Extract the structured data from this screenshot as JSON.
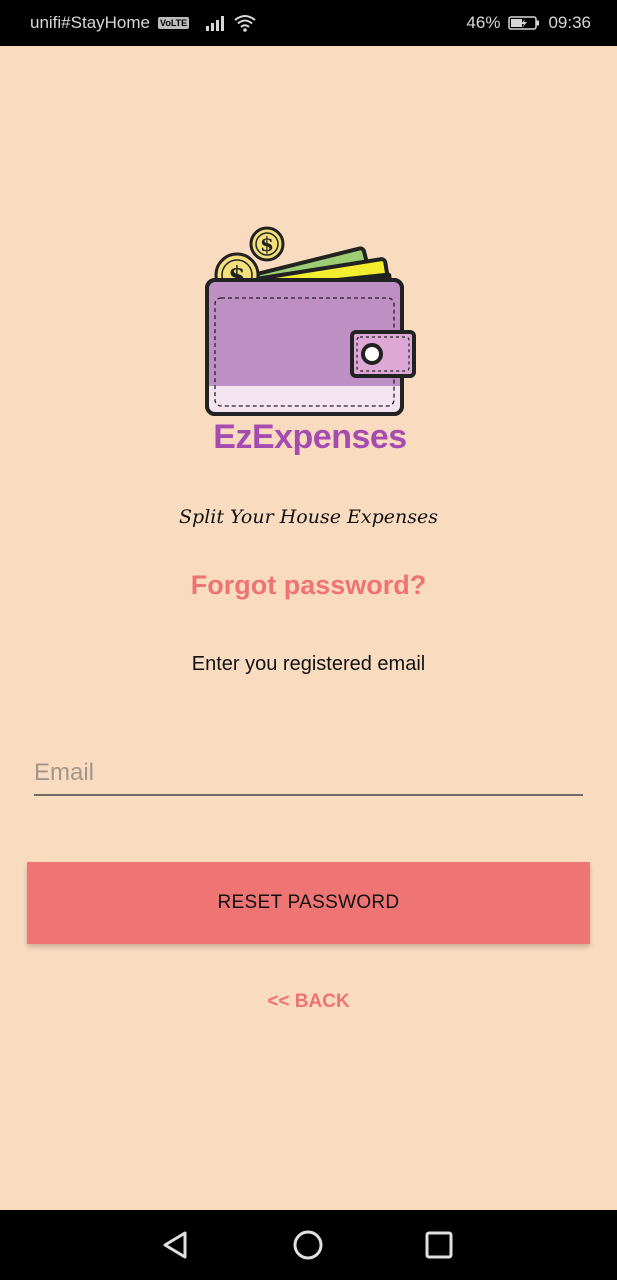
{
  "status_bar": {
    "carrier": "unifi#StayHome",
    "volte": "VoLTE",
    "battery": "46%",
    "time": "09:36"
  },
  "logo": {
    "wordmark": "EzExpenses"
  },
  "tagline": "Split Your House Expenses",
  "title": "Forgot password?",
  "instruction": "Enter you registered email",
  "email_field": {
    "placeholder": "Email",
    "value": ""
  },
  "reset_button": "RESET PASSWORD",
  "back_link": "<< BACK",
  "nav_bar": {
    "icons": [
      "back-triangle-icon",
      "home-circle-icon",
      "recents-square-icon"
    ]
  },
  "colors": {
    "background": "#f9dcc0",
    "accent": "#ee7474",
    "wallet_purple": "#be8fc2"
  }
}
